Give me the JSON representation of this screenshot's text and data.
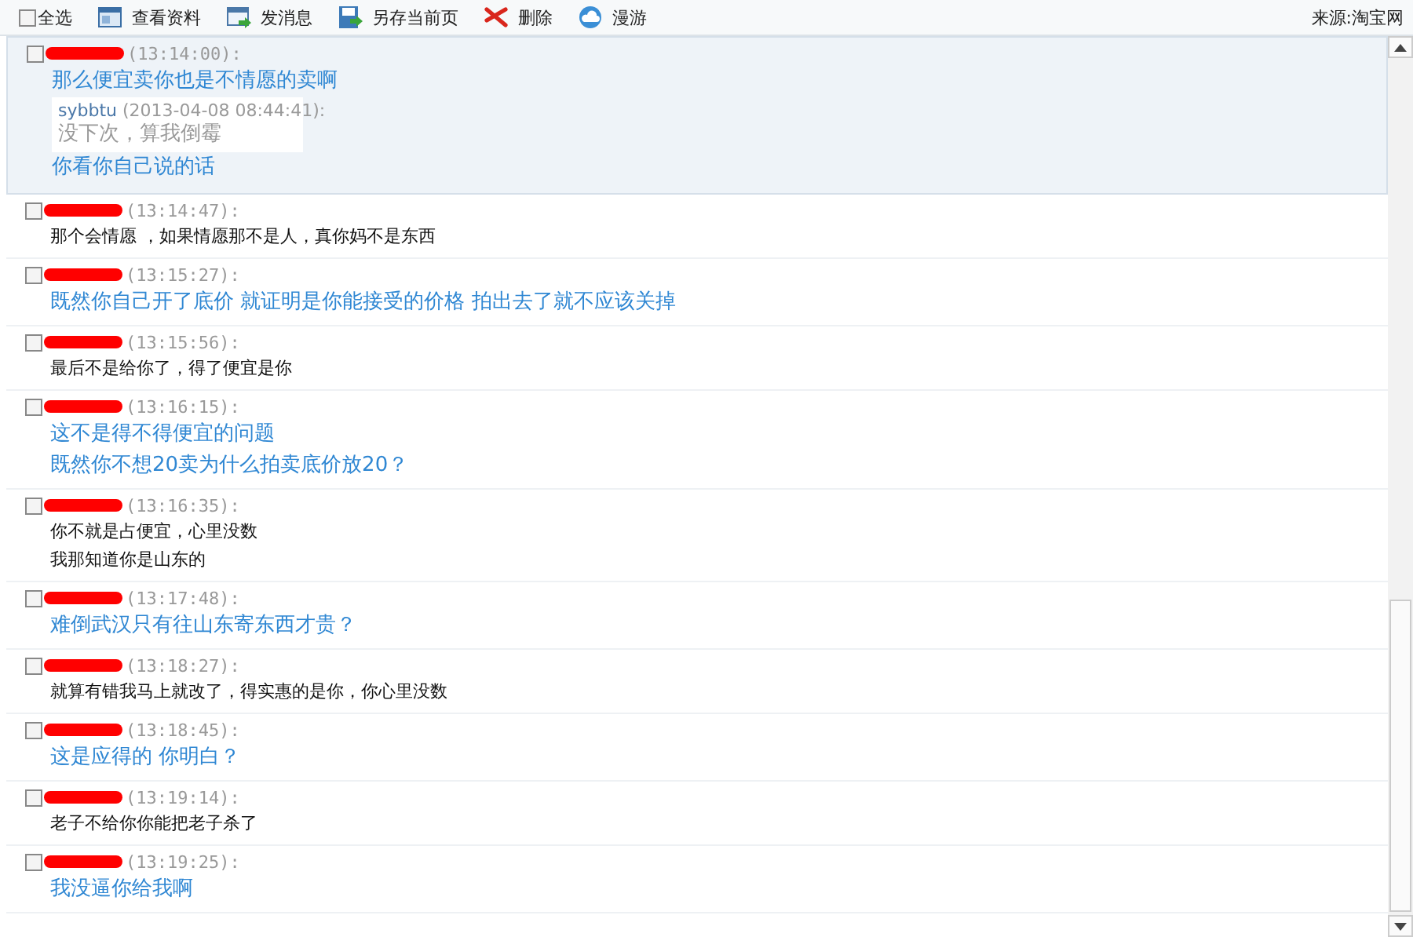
{
  "toolbar": {
    "select_all": {
      "label": "全选",
      "checked": false
    },
    "actions": [
      {
        "kind": "profile",
        "label": "查看资料"
      },
      {
        "kind": "message",
        "label": "发消息"
      },
      {
        "kind": "save",
        "label": "另存当前页"
      },
      {
        "kind": "delete",
        "label": "删除"
      },
      {
        "kind": "roam",
        "label": "漫游"
      }
    ],
    "source": "来源:淘宝网"
  },
  "messages": [
    {
      "time": "(13:14:00):",
      "checked": false,
      "selected": true,
      "kind": "large",
      "body": [
        {
          "kind": "line",
          "text": "那么便宜卖你也是不情愿的卖啊"
        },
        {
          "kind": "quote",
          "author": "sybbtu",
          "time": "(2013-04-08 08:44:41):",
          "text": "没下次，算我倒霉"
        },
        {
          "kind": "line",
          "text": "你看你自己说的话"
        }
      ]
    },
    {
      "time": "(13:14:47):",
      "checked": false,
      "selected": false,
      "kind": "small",
      "body": [
        {
          "kind": "line",
          "text": "那个会情愿 ，如果情愿那不是人，真你妈不是东西"
        }
      ]
    },
    {
      "time": "(13:15:27):",
      "checked": false,
      "selected": false,
      "kind": "large",
      "body": [
        {
          "kind": "line",
          "text": "既然你自己开了底价 就证明是你能接受的价格 拍出去了就不应该关掉"
        }
      ]
    },
    {
      "time": "(13:15:56):",
      "checked": false,
      "selected": false,
      "kind": "small",
      "body": [
        {
          "kind": "line",
          "text": "最后不是给你了，得了便宜是你"
        }
      ]
    },
    {
      "time": "(13:16:15):",
      "checked": false,
      "selected": false,
      "kind": "large",
      "body": [
        {
          "kind": "line",
          "text": "这不是得不得便宜的问题"
        },
        {
          "kind": "line",
          "text": "既然你不想20卖为什么拍卖底价放20？"
        }
      ]
    },
    {
      "time": "(13:16:35):",
      "checked": false,
      "selected": false,
      "kind": "small",
      "body": [
        {
          "kind": "line",
          "text": "你不就是占便宜，心里没数"
        },
        {
          "kind": "line",
          "text": "我那知道你是山东的"
        }
      ]
    },
    {
      "time": "(13:17:48):",
      "checked": false,
      "selected": false,
      "kind": "large",
      "body": [
        {
          "kind": "line",
          "text": "难倒武汉只有往山东寄东西才贵？"
        }
      ]
    },
    {
      "time": "(13:18:27):",
      "checked": false,
      "selected": false,
      "kind": "small",
      "body": [
        {
          "kind": "line",
          "text": "就算有错我马上就改了，得实惠的是你，你心里没数"
        }
      ]
    },
    {
      "time": "(13:18:45):",
      "checked": false,
      "selected": false,
      "kind": "large",
      "body": [
        {
          "kind": "line",
          "text": "这是应得的 你明白？"
        }
      ]
    },
    {
      "time": "(13:19:14):",
      "checked": false,
      "selected": false,
      "kind": "small",
      "body": [
        {
          "kind": "line",
          "text": "老子不给你你能把老子杀了"
        }
      ]
    },
    {
      "time": "(13:19:25):",
      "checked": false,
      "selected": false,
      "kind": "large",
      "body": [
        {
          "kind": "line",
          "text": "我没逼你给我啊"
        }
      ]
    }
  ]
}
